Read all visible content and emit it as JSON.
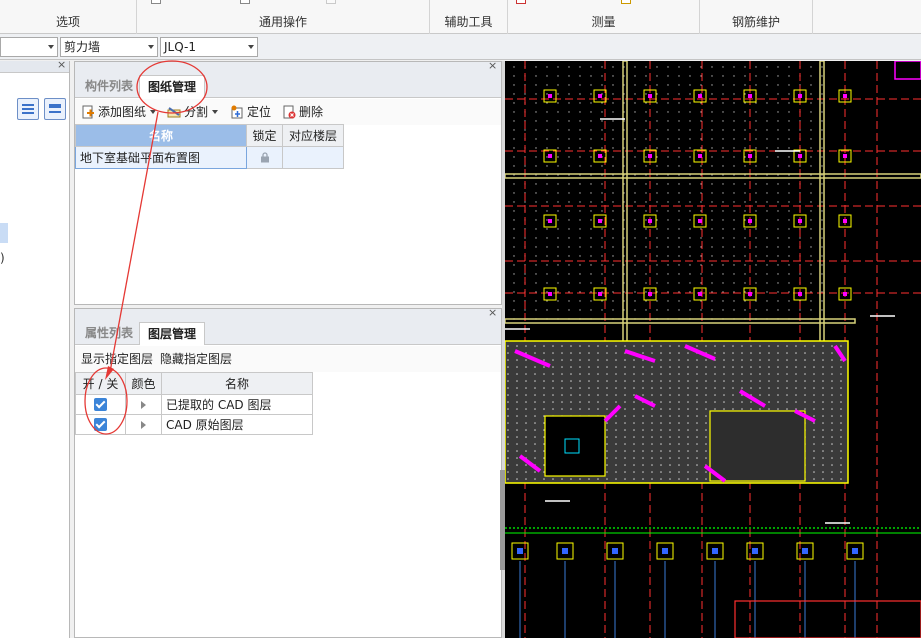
{
  "ribbon": {
    "groups": [
      "选项",
      "通用操作",
      "辅助工具",
      "测量",
      "钢筋维护"
    ]
  },
  "combos": {
    "c1_value": "",
    "c2_value": "剪力墙",
    "c3_value": "JLQ-1"
  },
  "drawing_panel": {
    "tabs": [
      "构件列表",
      "图纸管理"
    ],
    "active_tab": "图纸管理",
    "toolbar": {
      "add": "添加图纸",
      "split": "分割",
      "locate": "定位",
      "delete": "删除"
    },
    "columns": [
      "名称",
      "锁定",
      "对应楼层"
    ],
    "rows": [
      {
        "name": "地下室基础平面布置图",
        "locked": "",
        "floor": ""
      }
    ]
  },
  "layer_panel": {
    "tabs": [
      "属性列表",
      "图层管理"
    ],
    "active_tab": "图层管理",
    "actions": {
      "show": "显示指定图层",
      "hide": "隐藏指定图层"
    },
    "columns": [
      "开 / 关",
      "颜色",
      "名称"
    ],
    "rows": [
      {
        "name": "已提取的 CAD 图层"
      },
      {
        "name": "CAD 原始图层"
      }
    ]
  },
  "left_pane": {
    "paren": ")"
  },
  "colors": {
    "cad_bg": "#000000",
    "grid_red": "#ff3030",
    "wall_yellow": "#ffff00",
    "rebar_magenta": "#ff00ff",
    "beam_green": "#00ff00",
    "selection_blue": "#9bbde8",
    "annotation_red": "#e53935"
  }
}
